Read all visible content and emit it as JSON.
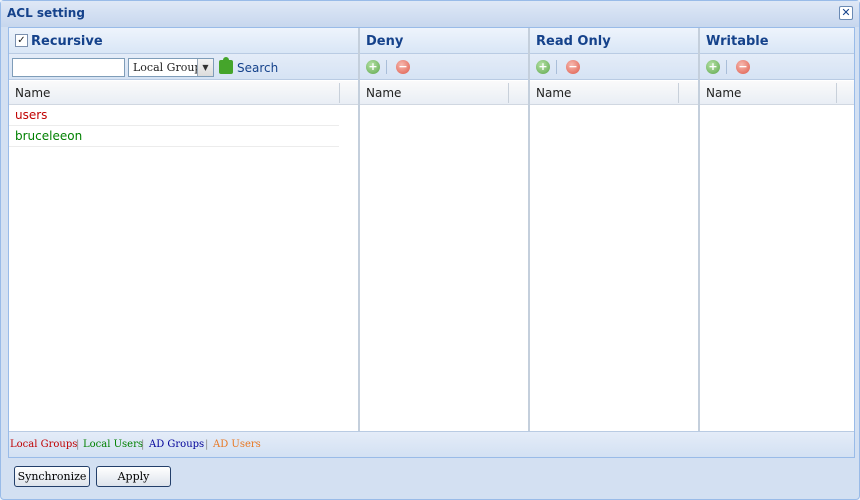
{
  "window": {
    "title": "ACL setting",
    "close_symbol": "✕"
  },
  "left_panel": {
    "recursive_label": "Recursive",
    "recursive_checked": true,
    "check_symbol": "✓",
    "search_value": "",
    "search_placeholder": "",
    "scope_select_value": "Local Groups",
    "select_arrow": "▼",
    "search_button_label": "Search",
    "column_header": "Name",
    "rows": [
      {
        "label": "users",
        "color": "#c00000"
      },
      {
        "label": "bruceleeon",
        "color": "#008000"
      }
    ]
  },
  "columns": [
    {
      "title": "Deny",
      "header": "Name"
    },
    {
      "title": "Read Only",
      "header": "Name"
    },
    {
      "title": "Writable",
      "header": "Name"
    }
  ],
  "toolbar_icons": {
    "add_symbol": "+",
    "remove_symbol": "−"
  },
  "legend": {
    "items": [
      {
        "label": "Local Groups",
        "color": "#c00000"
      },
      {
        "label": "Local Users",
        "color": "#008000"
      },
      {
        "label": "AD Groups",
        "color": "#000099"
      },
      {
        "label": "AD Users",
        "color": "#e87722"
      }
    ],
    "separator": "|"
  },
  "buttons": {
    "synchronize": "Synchronize",
    "apply": "Apply"
  }
}
